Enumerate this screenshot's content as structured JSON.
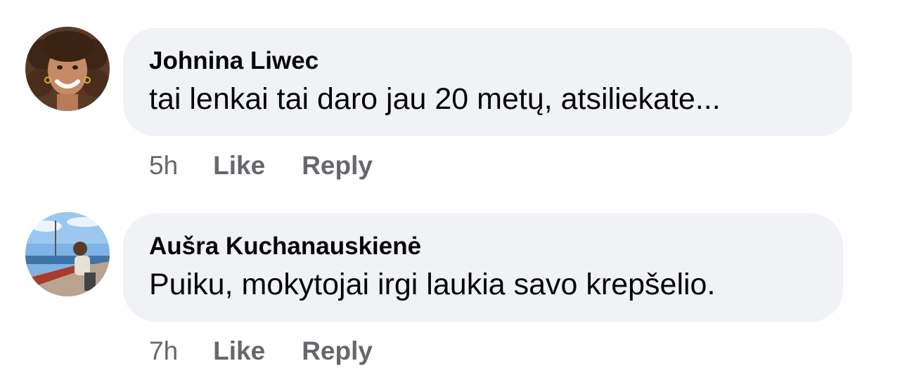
{
  "comments": [
    {
      "author": "Johnina Liwec",
      "text": "tai lenkai tai daro jau 20 metų, atsiliekate...",
      "time": "5h",
      "like_label": "Like",
      "reply_label": "Reply"
    },
    {
      "author": "Aušra Kuchanauskienė",
      "text": "Puiku, mokytojai irgi laukia savo krepšelio.",
      "time": "7h",
      "like_label": "Like",
      "reply_label": "Reply"
    }
  ],
  "colors": {
    "bubble_bg": "#f0f2f5",
    "text": "#050505",
    "meta": "#65676b"
  }
}
